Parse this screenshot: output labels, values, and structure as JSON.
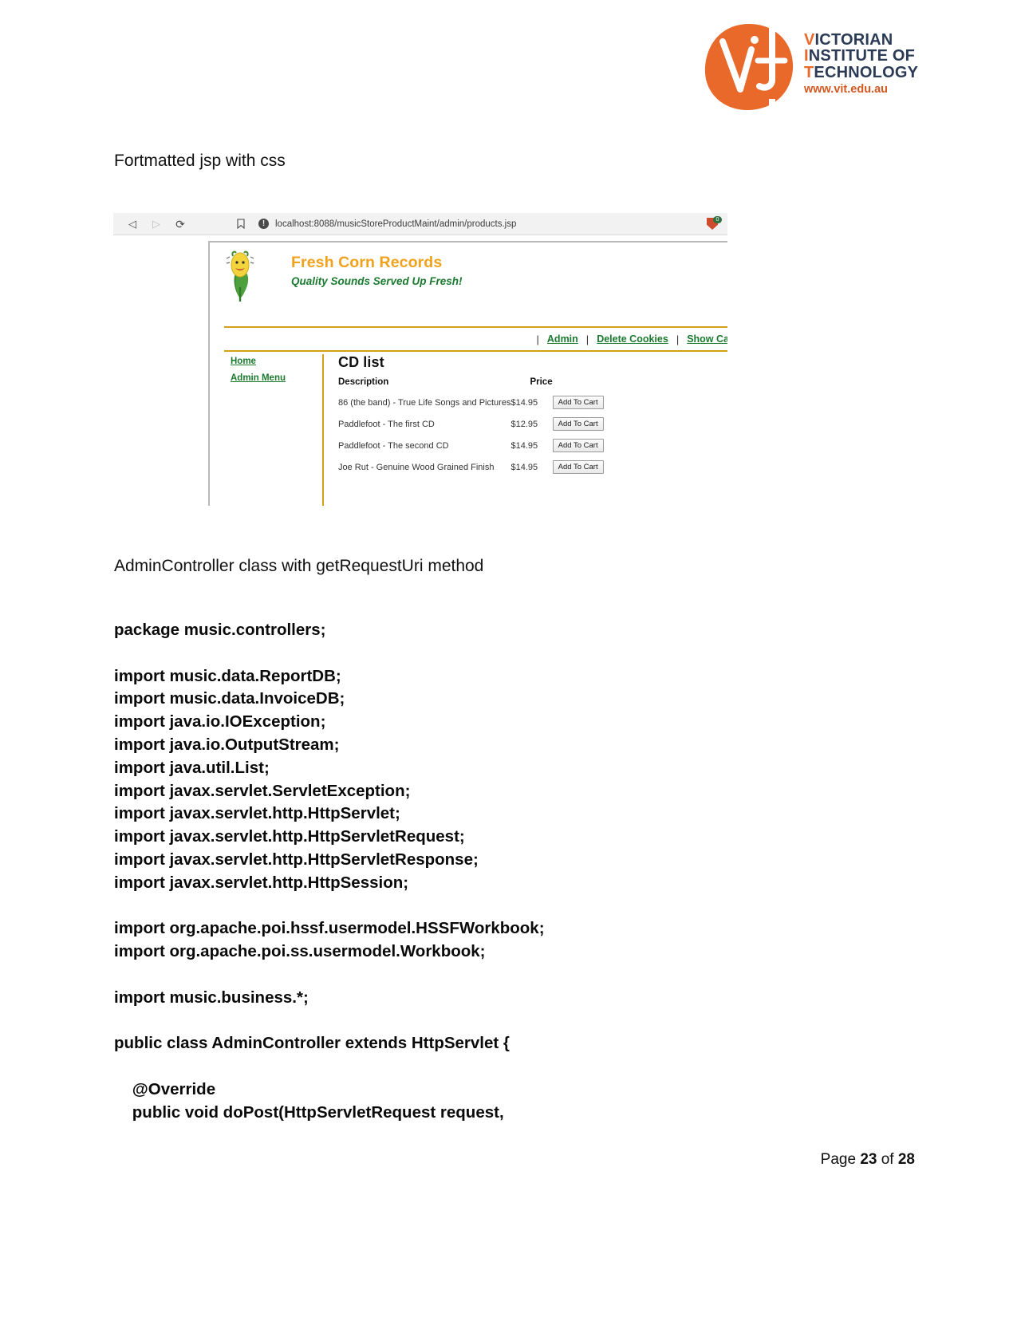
{
  "logo": {
    "line1_hl": "V",
    "line1_rest": "ICTORIAN",
    "line2_hl": "I",
    "line2_rest": "NSTITUTE OF",
    "line3_hl": "T",
    "line3_rest": "ECHNOLOGY",
    "url": "www.vit.edu.au",
    "brand_orange": "#e8692a",
    "brand_navy": "#2b3a55"
  },
  "document": {
    "caption_1": "Fortmatted jsp with css",
    "caption_2": "AdminController class with getRequestUri method",
    "code": "package music.controllers;\n\nimport music.data.ReportDB;\nimport music.data.InvoiceDB;\nimport java.io.IOException;\nimport java.io.OutputStream;\nimport java.util.List;\nimport javax.servlet.ServletException;\nimport javax.servlet.http.HttpServlet;\nimport javax.servlet.http.HttpServletRequest;\nimport javax.servlet.http.HttpServletResponse;\nimport javax.servlet.http.HttpSession;\n\nimport org.apache.poi.hssf.usermodel.HSSFWorkbook;\nimport org.apache.poi.ss.usermodel.Workbook;\n\nimport music.business.*;\n\npublic class AdminController extends HttpServlet {\n\n    @Override\n    public void doPost(HttpServletRequest request,",
    "footer_prefix": "Page ",
    "footer_page": "23",
    "footer_mid": " of ",
    "footer_total": "28"
  },
  "browser": {
    "back_icon": "◁",
    "forward_icon": "▷",
    "reload_icon": "⟳",
    "bookmark_icon": "🔖",
    "info_icon": "!",
    "url": "localhost:8088/musicStoreProductMaint/admin/products.jsp",
    "extension_badge": "0"
  },
  "site": {
    "title": "Fresh Corn Records",
    "tagline": "Quality Sounds Served Up Fresh!",
    "title_color": "#f0a21c",
    "tagline_color": "#1a7a2e",
    "rule_color": "#d4a017",
    "nav": [
      {
        "label": "Admin"
      },
      {
        "label": "Delete Cookies"
      },
      {
        "label": "Show Ca"
      }
    ],
    "nav_separator": "|",
    "sidebar": [
      {
        "label": "Home"
      },
      {
        "label": "Admin Menu"
      }
    ],
    "main": {
      "heading": "CD list",
      "columns": {
        "description": "Description",
        "price": "Price"
      },
      "rows": [
        {
          "description": "86 (the band) - True Life Songs and Pictures",
          "price": "$14.95",
          "button": "Add To Cart"
        },
        {
          "description": "Paddlefoot - The first CD",
          "price": "$12.95",
          "button": "Add To Cart"
        },
        {
          "description": "Paddlefoot - The second CD",
          "price": "$14.95",
          "button": "Add To Cart"
        },
        {
          "description": "Joe Rut - Genuine Wood Grained Finish",
          "price": "$14.95",
          "button": "Add To Cart"
        }
      ]
    }
  }
}
